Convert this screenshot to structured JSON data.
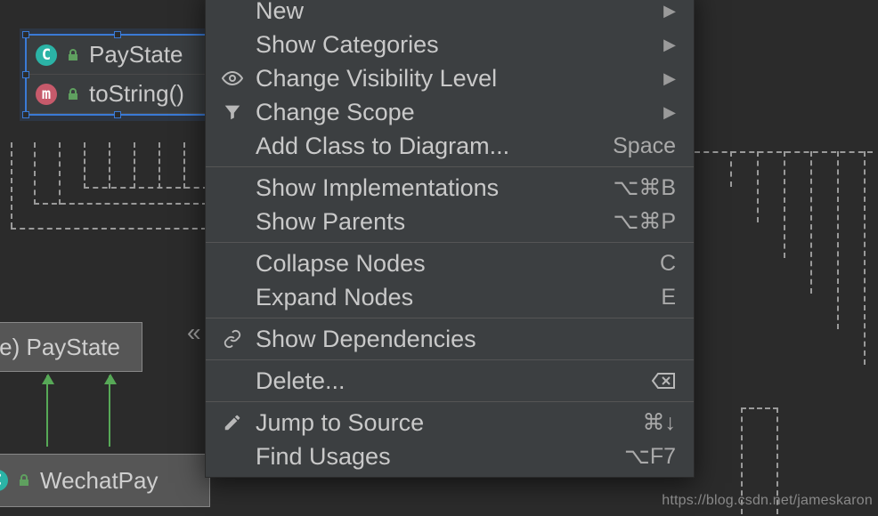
{
  "nodes": {
    "paystate_class": "PayState",
    "tostring_method": "toString()",
    "paystate_return": "le) PayState",
    "wechatpay": "WechatPay",
    "badge_c": "C",
    "badge_m": "m",
    "guillemet": "«"
  },
  "menu": {
    "new": "New",
    "show_categories": "Show Categories",
    "change_visibility": "Change Visibility Level",
    "change_scope": "Change Scope",
    "add_class": "Add Class to Diagram...",
    "add_class_key": "Space",
    "show_impl": "Show Implementations",
    "show_impl_key": "⌥⌘B",
    "show_parents": "Show Parents",
    "show_parents_key": "⌥⌘P",
    "collapse": "Collapse Nodes",
    "collapse_key": "C",
    "expand": "Expand Nodes",
    "expand_key": "E",
    "show_deps": "Show Dependencies",
    "delete": "Delete...",
    "jump": "Jump to Source",
    "jump_key": "⌘↓",
    "find_usages": "Find Usages",
    "find_usages_key": "⌥F7",
    "arrow": "▶"
  },
  "watermark": "https://blog.csdn.net/jameskaron"
}
